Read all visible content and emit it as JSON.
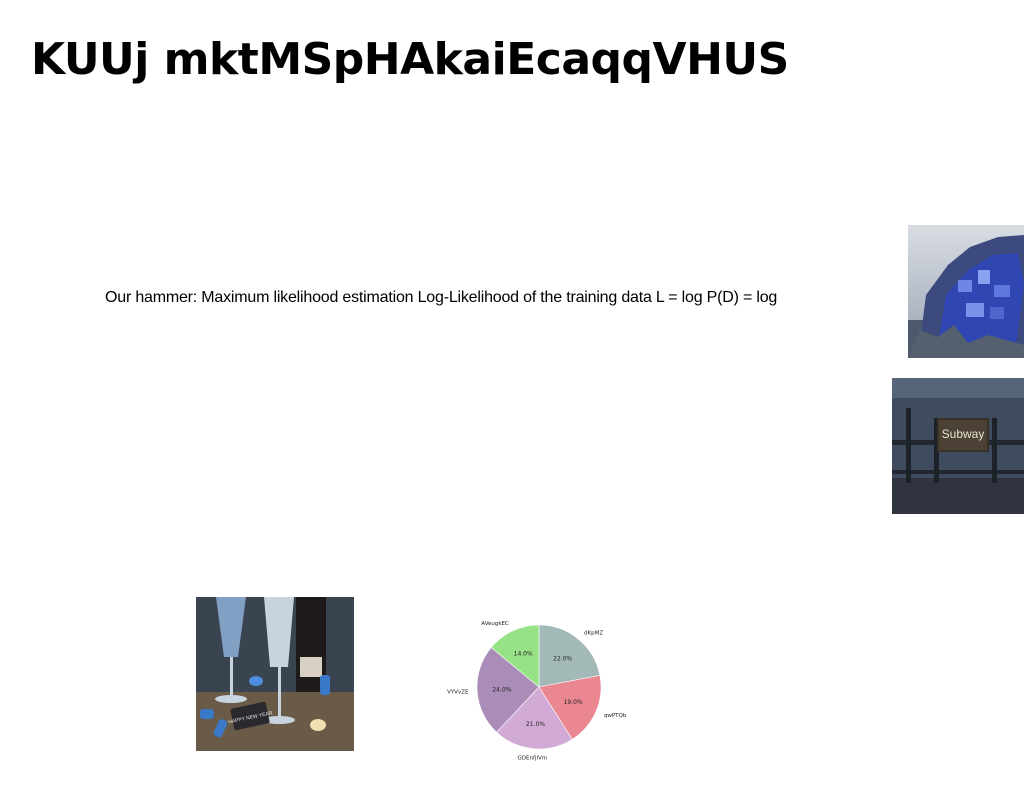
{
  "page": {
    "title": "KUUj mktMSpHAkaiEcaqqVHUS",
    "body_text": "Our hammer: Maximum likelihood estimation Log-Likelihood of the training data L = log P(D) = log",
    "subway_sign": "Subway",
    "party_sign": "HAPPY NEW YEAR"
  },
  "images": [
    {
      "name": "cliff-village-photo",
      "description": "coastal cliff village"
    },
    {
      "name": "subway-sign-photo",
      "description": "subway railing"
    },
    {
      "name": "celebration-photo",
      "description": "champagne glasses"
    }
  ],
  "chart_data": {
    "type": "pie",
    "title": "",
    "slices": [
      {
        "label": "dKpMZ",
        "value": 22.0,
        "pct_label": "22.0%",
        "color": "#a3b9b8"
      },
      {
        "label": "qwPTQb",
        "value": 19.0,
        "pct_label": "19.0%",
        "color": "#ea8790"
      },
      {
        "label": "GDEnfjlVm",
        "value": 21.0,
        "pct_label": "21.0%",
        "color": "#d2aad6"
      },
      {
        "label": "VYVvZE",
        "value": 24.0,
        "pct_label": "24.0%",
        "color": "#a98cb8"
      },
      {
        "label": "AVeugkEC",
        "value": 14.0,
        "pct_label": "14.0%",
        "color": "#97e287"
      }
    ],
    "start_angle": "top",
    "direction": "clockwise"
  }
}
